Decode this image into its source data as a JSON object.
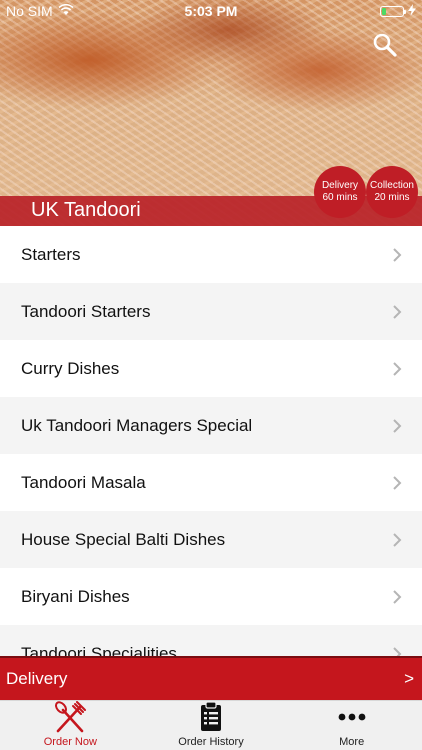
{
  "status_bar": {
    "carrier": "No SIM",
    "time": "5:03 PM"
  },
  "header": {
    "restaurant_name": "UK Tandoori",
    "delivery_badge": {
      "label": "Delivery",
      "time": "60 mins"
    },
    "collection_badge": {
      "label": "Collection",
      "time": "20 mins"
    }
  },
  "menu": {
    "items": [
      {
        "label": "Starters"
      },
      {
        "label": "Tandoori Starters"
      },
      {
        "label": "Curry Dishes"
      },
      {
        "label": "Uk Tandoori Managers Special"
      },
      {
        "label": "Tandoori Masala"
      },
      {
        "label": "House Special Balti Dishes"
      },
      {
        "label": "Biryani Dishes"
      },
      {
        "label": "Tandoori Specialities"
      }
    ]
  },
  "delivery_bar": {
    "label": "Delivery",
    "arrow": ">"
  },
  "tab_bar": {
    "tabs": [
      {
        "label": "Order Now",
        "icon": "fork-knife-icon",
        "active": true
      },
      {
        "label": "Order History",
        "icon": "clipboard-list-icon",
        "active": false
      },
      {
        "label": "More",
        "icon": "more-dots-icon",
        "active": false
      }
    ]
  },
  "colors": {
    "brand_red": "#c5161d",
    "title_bar_red": "#b82228",
    "active_tab": "#c5161d",
    "battery_low": "#4cd964"
  }
}
